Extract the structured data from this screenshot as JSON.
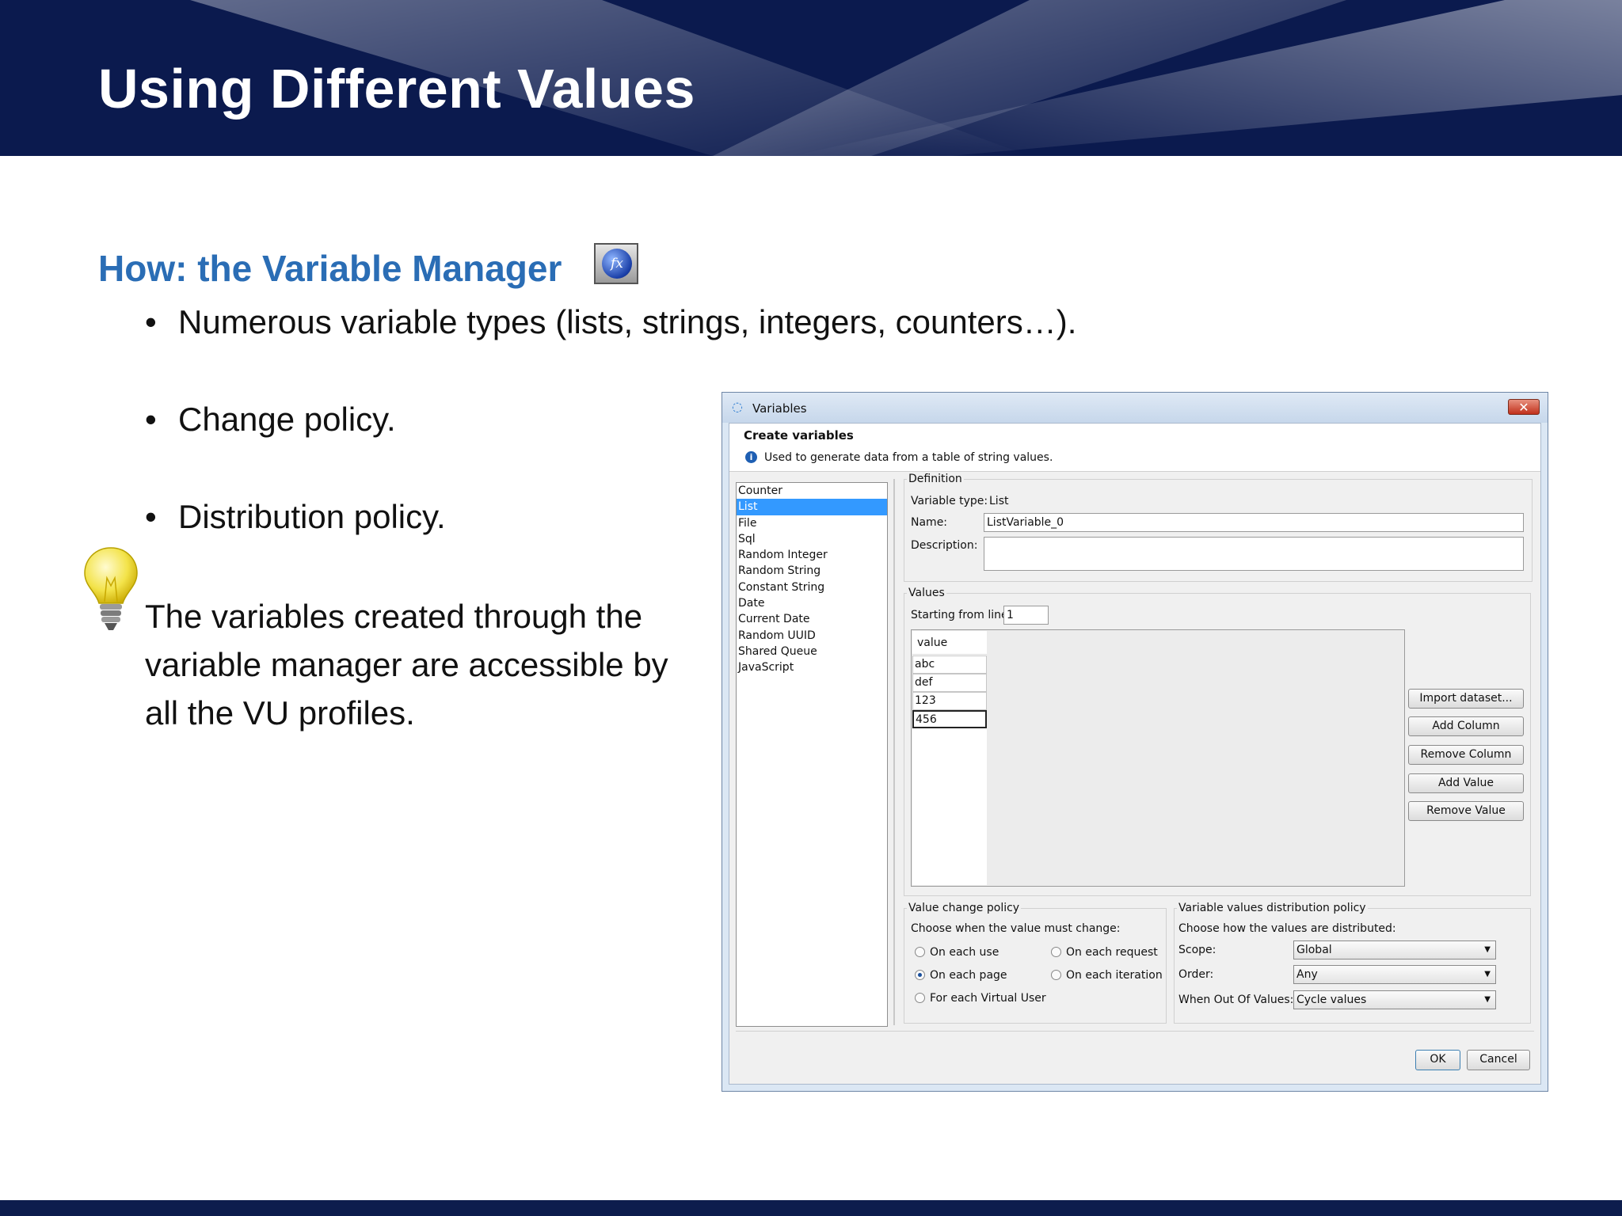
{
  "slide": {
    "title": "Using Different Values",
    "subheading": "How: the Variable Manager",
    "fx_icon_label": "fx",
    "bullets": [
      "Numerous variable types (lists, strings, integers, counters…).",
      "Change policy.",
      "Distribution policy."
    ],
    "bullet_glyph": "•",
    "note_lines": [
      "The variables created through the",
      "variable manager are accessible by",
      "all the VU profiles."
    ]
  },
  "dialog": {
    "title": "Variables",
    "close_glyph": "✕",
    "heading": "Create variables",
    "info": "Used to generate data from a table of string values.",
    "types": [
      "Counter",
      "List",
      "File",
      "Sql",
      "Random Integer",
      "Random String",
      "Constant String",
      "Date",
      "Current Date",
      "Random UUID",
      "Shared Queue",
      "JavaScript"
    ],
    "selected_type": "List",
    "definition": {
      "group": "Definition",
      "type_label": "Variable type:",
      "type_value": "List",
      "name_label": "Name:",
      "name_value": "ListVariable_0",
      "description_label": "Description:",
      "description_value": ""
    },
    "values": {
      "group": "Values",
      "start_label": "Starting from line:",
      "start_value": "1",
      "column_header": "value",
      "rows": [
        "abc",
        "def",
        "123",
        "456"
      ],
      "buttons": [
        "Import dataset...",
        "Add Column",
        "Remove Column",
        "Add Value",
        "Remove Value"
      ]
    },
    "change_policy": {
      "group": "Value change policy",
      "prompt": "Choose when the value must change:",
      "options": [
        "On each use",
        "On each request",
        "On each page",
        "On each iteration",
        "For each Virtual User"
      ],
      "selected": "On each page"
    },
    "distribution_policy": {
      "group": "Variable values distribution policy",
      "prompt": "Choose how the values are distributed:",
      "scope_label": "Scope:",
      "scope_value": "Global",
      "order_label": "Order:",
      "order_value": "Any",
      "out_label": "When Out Of Values:",
      "out_value": "Cycle values"
    },
    "ok_label": "OK",
    "cancel_label": "Cancel"
  }
}
